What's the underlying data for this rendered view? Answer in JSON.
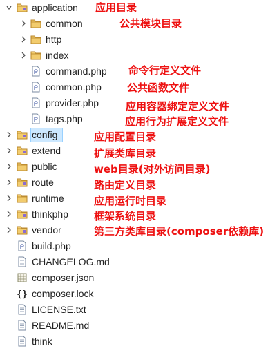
{
  "tree": {
    "items": [
      {
        "label": "application",
        "type": "folder-pkg",
        "expanded": true
      },
      {
        "label": "common",
        "type": "folder",
        "expanded": false
      },
      {
        "label": "http",
        "type": "folder",
        "expanded": false
      },
      {
        "label": "index",
        "type": "folder",
        "expanded": false
      },
      {
        "label": "command.php",
        "type": "php"
      },
      {
        "label": "common.php",
        "type": "php"
      },
      {
        "label": "provider.php",
        "type": "php"
      },
      {
        "label": "tags.php",
        "type": "php"
      },
      {
        "label": "config",
        "type": "folder-pkg",
        "expanded": false,
        "selected": true
      },
      {
        "label": "extend",
        "type": "folder-pkg",
        "expanded": false
      },
      {
        "label": "public",
        "type": "folder",
        "expanded": false
      },
      {
        "label": "route",
        "type": "folder-pkg",
        "expanded": false
      },
      {
        "label": "runtime",
        "type": "folder",
        "expanded": false
      },
      {
        "label": "thinkphp",
        "type": "folder-pkg",
        "expanded": false
      },
      {
        "label": "vendor",
        "type": "folder-pkg",
        "expanded": false
      },
      {
        "label": "build.php",
        "type": "php"
      },
      {
        "label": "CHANGELOG.md",
        "type": "text"
      },
      {
        "label": "composer.json",
        "type": "json"
      },
      {
        "label": "composer.lock",
        "type": "braces"
      },
      {
        "label": "LICENSE.txt",
        "type": "text"
      },
      {
        "label": "README.md",
        "type": "text"
      },
      {
        "label": "think",
        "type": "text"
      }
    ]
  },
  "annotations": {
    "application": "应用目录",
    "common": "公共模块目录",
    "command": "命令行定义文件",
    "common_php": "公共函数文件",
    "provider": "应用容器绑定定义文件",
    "tags": "应用行为扩展定义文件",
    "config": "应用配置目录",
    "extend": "扩展类库目录",
    "public": "web目录(对外访问目录)",
    "route": "路由定义目录",
    "runtime": "应用运行时目录",
    "thinkphp": "框架系统目录",
    "vendor": "第三方类库目录(composer依赖库)"
  },
  "colors": {
    "annotation": "#ee1111",
    "folder": "#e8b84a",
    "selection": "#cce8ff"
  }
}
